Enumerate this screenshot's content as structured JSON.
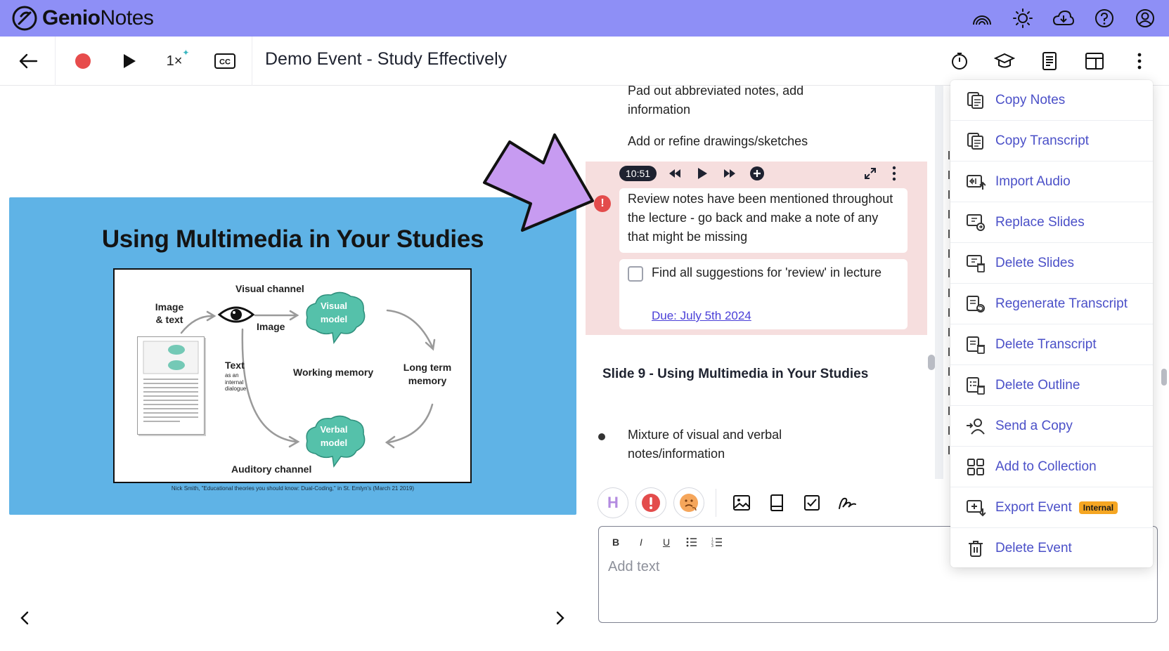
{
  "app": {
    "brand_bold": "Genio",
    "brand_light": "Notes",
    "accent": "#8e8ff6"
  },
  "topbar": {
    "icons": [
      "signal-icon",
      "brightness-icon",
      "cloud-icon",
      "help-icon",
      "account-icon"
    ]
  },
  "toolbar": {
    "playback_speed": "1×",
    "title": "Demo Event - Study Effectively",
    "right_icons": [
      "timer-icon",
      "graduation-cap-icon",
      "document-icon",
      "layout-icon",
      "more-vertical-icon"
    ]
  },
  "slide": {
    "title": "Using Multimedia in Your Studies",
    "caption": "Nick Smith, \"Educational theories you should know: Dual-Coding,\" in St. Emlyn's (March 21 2019)",
    "diagram": {
      "visual_channel": "Visual channel",
      "image_text": "Image & text",
      "image": "Image",
      "text": "Text",
      "text_note": "as an internal dialogue",
      "working_memory": "Working memory",
      "long_term_memory": "Long term memory",
      "visual_model": "Visual model",
      "verbal_model": "Verbal model",
      "auditory_channel": "Auditory channel"
    }
  },
  "notes": {
    "pad_out": "Pad out abbreviated notes, add information",
    "refine": "Add or refine drawings/sketches",
    "timestamp": "10:51",
    "review_note": "Review notes have been mentioned throughout the lecture - go back and make a note of any that might be missing",
    "task": "Find all suggestions for 'review' in lecture",
    "due": "Due: July 5th 2024",
    "section_heading": "Slide 9 - Using Multimedia in Your Studies",
    "bullet": "Mixture of visual and verbal notes/information"
  },
  "editor": {
    "placeholder": "Add text",
    "heading_button": "H",
    "alert_button": "!"
  },
  "menu": {
    "items": [
      {
        "label": "Copy Notes",
        "icon": "copy-notes-icon"
      },
      {
        "label": "Copy Transcript",
        "icon": "copy-transcript-icon"
      },
      {
        "label": "Import Audio",
        "icon": "import-audio-icon"
      },
      {
        "label": "Replace Slides",
        "icon": "replace-slides-icon"
      },
      {
        "label": "Delete Slides",
        "icon": "delete-slides-icon"
      },
      {
        "label": "Regenerate Transcript",
        "icon": "regenerate-transcript-icon"
      },
      {
        "label": "Delete Transcript",
        "icon": "delete-transcript-icon"
      },
      {
        "label": "Delete Outline",
        "icon": "delete-outline-icon"
      },
      {
        "label": "Send a Copy",
        "icon": "send-copy-icon"
      },
      {
        "label": "Add to Collection",
        "icon": "collection-icon"
      },
      {
        "label": "Export Event",
        "icon": "export-event-icon",
        "badge": "Internal"
      },
      {
        "label": "Delete Event",
        "icon": "trash-icon"
      }
    ]
  }
}
